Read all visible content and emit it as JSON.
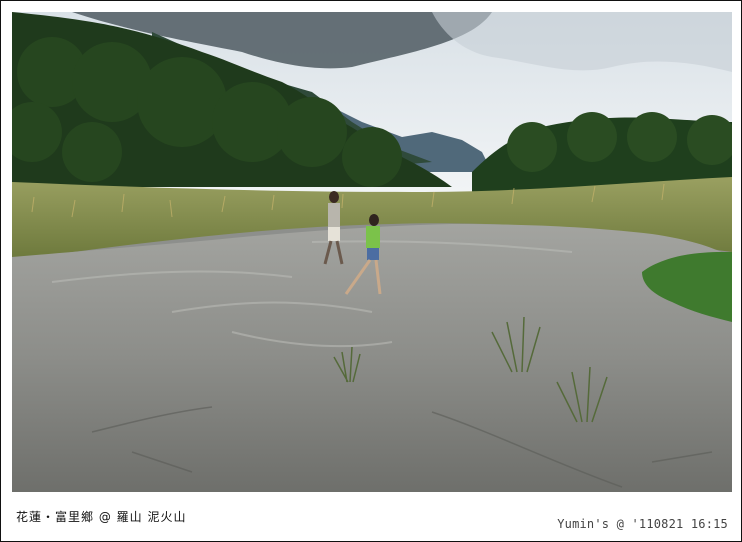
{
  "caption": {
    "location": "花蓮・富里鄉 @ 羅山 泥火山",
    "watermark": "Yumin's @ '110821 16:15"
  },
  "photo": {
    "subject": "mud-volcano-landscape",
    "colors": {
      "sky": "#eef2f5",
      "cloud": "#c9d0d6",
      "mountain": "#3f5a66",
      "forest": "#1f3d1a",
      "grass": "#a9a05a",
      "mud": "#8e8f8b",
      "mud_dark": "#6f706c"
    }
  }
}
